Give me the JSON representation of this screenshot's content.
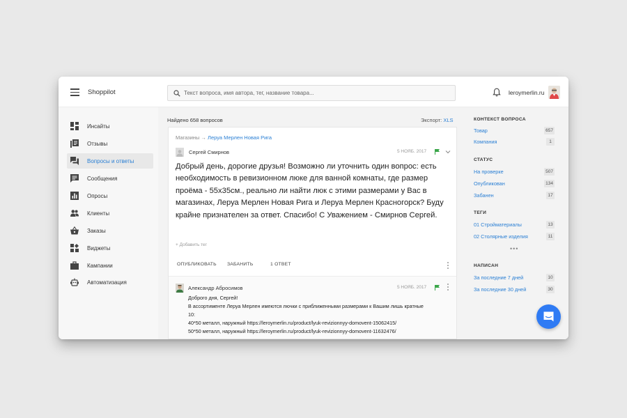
{
  "app": {
    "title": "Shoppilot",
    "search_placeholder": "Текст вопроса, имя автора, тег, название товара...",
    "account": "leroymerlin.ru"
  },
  "nav": [
    {
      "label": "Инсайты",
      "icon": "insights-icon"
    },
    {
      "label": "Отзывы",
      "icon": "reviews-icon"
    },
    {
      "label": "Вопросы и ответы",
      "icon": "qa-icon",
      "active": true
    },
    {
      "label": "Сообщения",
      "icon": "messages-icon"
    },
    {
      "label": "Опросы",
      "icon": "polls-icon"
    },
    {
      "label": "Клиенты",
      "icon": "clients-icon"
    },
    {
      "label": "Заказы",
      "icon": "orders-icon"
    },
    {
      "label": "Виджеты",
      "icon": "widgets-icon"
    },
    {
      "label": "Кампании",
      "icon": "campaigns-icon"
    },
    {
      "label": "Автоматизация",
      "icon": "automation-icon"
    }
  ],
  "list": {
    "found": "Найдено 658 вопросов",
    "export_label": "Экспорт:",
    "export_link": "XLS"
  },
  "question": {
    "crumb_root": "Магазины",
    "crumb_arrow": "→",
    "crumb_store": "Леруа Мерлен Новая Рига",
    "author": "Сергей Смирнов",
    "date": "5 НОЯБ. 2017",
    "text": "Добрый день, дорогие друзья! Возможно ли уточнить один вопрос: есть необходимость в ревизионном люке для ванной комнаты, где размер проёма - 55х35см., реально ли найти люк с этими размерами у Вас в магазинах, Леруа Мерлен Новая Рига и Леруа Мерлен Красногорск? Буду крайне признателен за ответ. Спасибо! С Уважением - Смирнов Сергей.",
    "add_tag": "+ Добавить тег",
    "actions": {
      "publish": "ОПУБЛИКОВАТЬ",
      "ban": "ЗАБАНИТЬ",
      "answers": "1 ОТВЕТ"
    }
  },
  "answer": {
    "author": "Александр Абросимов",
    "date": "5 НОЯБ. 2017",
    "lines": [
      "Доброго дня, Сергей!",
      "В ассортименте Леруа Мерлен имеются лючки с приближенными размерами к Вашим лишь кратные",
      "10:",
      "40*50 металл, наружный https://leroymerlin.ru/product/lyuk-revizionnyy-domovent-15062415/",
      "50*50 металл, наружный https://leroymerlin.ru/product/lyuk-revizionnyy-domovent-11632476/"
    ]
  },
  "facets": {
    "context": {
      "title": "КОНТЕКСТ ВОПРОСА",
      "items": [
        {
          "label": "Товар",
          "count": "657"
        },
        {
          "label": "Компания",
          "count": "1"
        }
      ]
    },
    "status": {
      "title": "СТАТУС",
      "items": [
        {
          "label": "На проверке",
          "count": "507"
        },
        {
          "label": "Опубликован",
          "count": "134"
        },
        {
          "label": "Забанен",
          "count": "17"
        }
      ]
    },
    "tags": {
      "title": "ТЕГИ",
      "items": [
        {
          "label": "01 Стройматериалы",
          "count": "13"
        },
        {
          "label": "02 Столярные изделия",
          "count": "11"
        }
      ],
      "more": "•••"
    },
    "written": {
      "title": "НАПИСАН",
      "items": [
        {
          "label": "За последние 7 дней",
          "count": "10"
        },
        {
          "label": "За последние 30 дней",
          "count": "30"
        }
      ]
    }
  },
  "colors": {
    "accent": "#2a7fd4",
    "flag": "#3aa64a",
    "chat": "#2f7bf4"
  }
}
